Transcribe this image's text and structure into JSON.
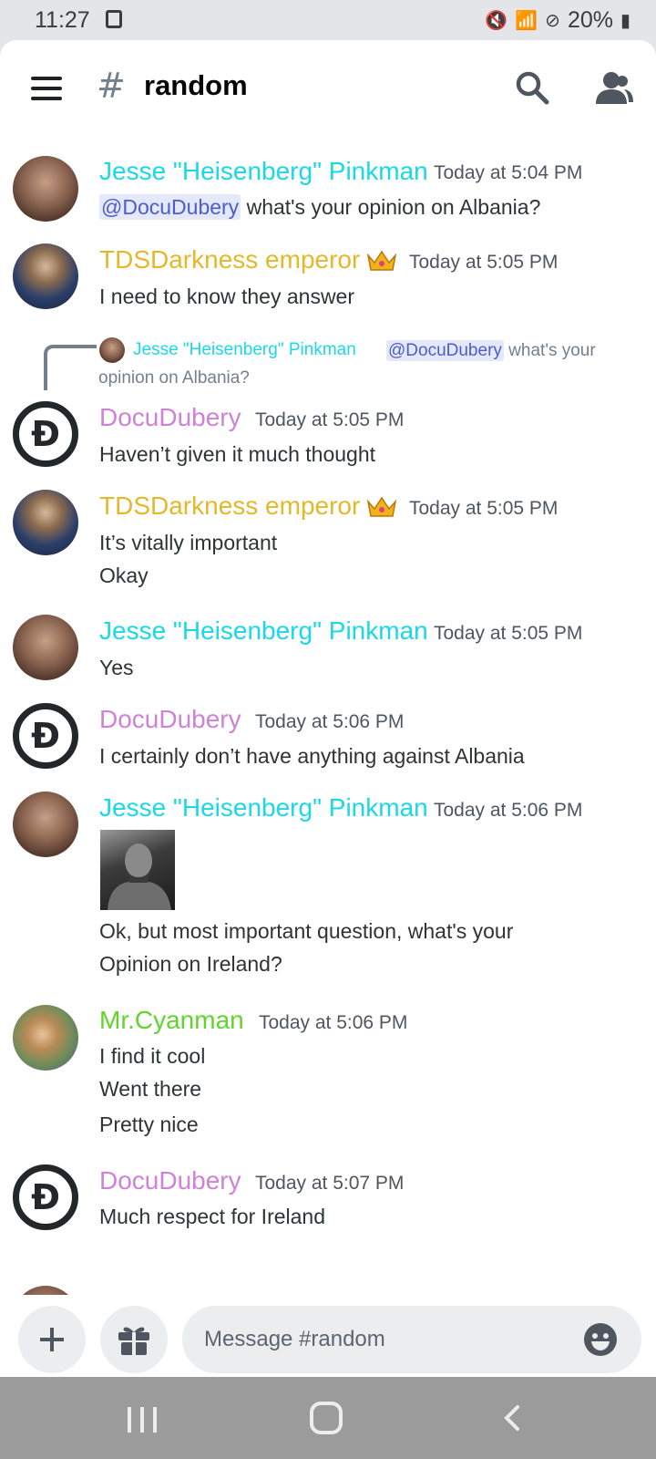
{
  "status_bar": {
    "time": "11:27",
    "battery": "20%"
  },
  "header": {
    "channel_name": "random"
  },
  "messages": [
    {
      "author": "Jesse \"Heisenberg\" Pinkman",
      "time": "Today at 5:04 PM",
      "mention": "@DocuDubery",
      "text": " what's your opinion on Albania?"
    },
    {
      "author": "TDSDarkness emperor",
      "time": "Today at 5:05 PM",
      "lines": [
        "I need to know they answer"
      ]
    },
    {
      "reply": {
        "author": "Jesse \"Heisenberg\" Pinkman",
        "mention": "@DocuDubery",
        "text": " what's your opinion on Albania?"
      },
      "author": "DocuDubery",
      "time": "Today at 5:05 PM",
      "lines": [
        "Haven’t given it much thought"
      ]
    },
    {
      "author": "TDSDarkness emperor",
      "time": "Today at 5:05 PM",
      "lines": [
        "It’s vitally important",
        "Okay"
      ]
    },
    {
      "author": "Jesse \"Heisenberg\" Pinkman",
      "time": "Today at 5:05 PM",
      "lines": [
        "Yes"
      ]
    },
    {
      "author": "DocuDubery",
      "time": "Today at 5:06 PM",
      "lines": [
        "I certainly don’t have anything against Albania"
      ]
    },
    {
      "author": "Jesse \"Heisenberg\" Pinkman",
      "time": "Today at 5:06 PM",
      "lines": [
        "Ok, but most important question, what's your",
        "Opinion on Ireland?"
      ]
    },
    {
      "author": "Mr.Cyanman",
      "time": "Today at 5:06 PM",
      "lines": [
        "I find it cool",
        "Went there",
        "Pretty nice"
      ]
    },
    {
      "author": "DocuDubery",
      "time": "Today at 5:07 PM",
      "lines": [
        "Much respect for Ireland"
      ]
    }
  ],
  "composer": {
    "placeholder": "Message #random"
  },
  "icons": [
    "menu-icon",
    "hash-icon",
    "search-icon",
    "members-icon",
    "crown-icon",
    "plus-icon",
    "gift-icon",
    "emoji-icon",
    "nav-recent-icon",
    "nav-home-icon",
    "nav-back-icon"
  ]
}
